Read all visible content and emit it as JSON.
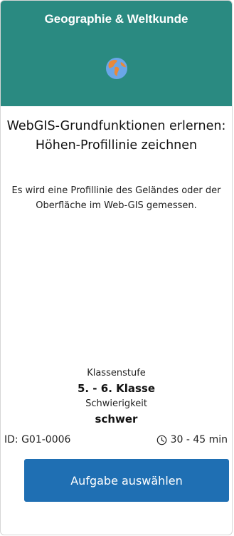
{
  "card": {
    "subject": "Geographie & Weltkunde",
    "subject_icon": "globe-icon",
    "title": "WebGIS-Grundfunktionen erlernen: Höhen-Profillinie zeichnen",
    "description": "Es wird eine Profillinie des Geländes oder der Oberfläche im Web-GIS gemessen.",
    "grade_label": "Klassenstufe",
    "grade_value": "5. - 6. Klasse",
    "difficulty_label": "Schwierigkeit",
    "difficulty_value": "schwer",
    "id_text": "ID: G01-0006",
    "duration_icon": "clock-icon",
    "duration": "30 - 45 min",
    "button_label": "Aufgabe auswählen"
  },
  "colors": {
    "header_bg": "#2a8a81",
    "globe_ocean": "#6aa6e8",
    "globe_land": "#e8893a",
    "button_bg": "#1f6fb3"
  }
}
